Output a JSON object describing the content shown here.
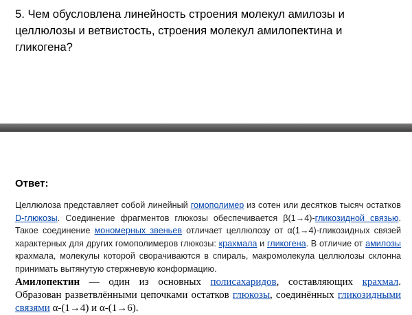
{
  "question": "5. Чем обусловлена линейность строения молекул амилозы и целлюлозы и ветвистость, строения молекул амилопектина и гликогена?",
  "answer_heading": "Ответ:",
  "para1": {
    "t1": "Целлюлоза представляет собой линейный ",
    "l1": "гомополимер",
    "t2": " из сотен или десятков тысяч остатков ",
    "l2": "D-глюкозы",
    "t3": ". Соединение фрагментов глюкозы обеспечивается β(1→4)-",
    "l3": "гликозидной связью",
    "t4": ". Такое соединение ",
    "l4": "мономерных звеньев",
    "t5": " отличает целлюлозу от α(1→4)-гликозидных связей характерных для других гомополимеров глюкозы: ",
    "l5": "крахмала",
    "t6": " и ",
    "l6": "гликогена",
    "t7": ". В отличие от ",
    "l7": "амилозы",
    "t8": " крахмала, молекулы которой сворачиваются в спираль, макромолекула целлюлозы склонна принимать вытянутую стержневую конформацию."
  },
  "para2": {
    "term": "Амилопектин",
    "t1": " — один из основных ",
    "l1": "полисахаридов",
    "t2": ", составляющих ",
    "l2": "крахмал",
    "t3": ". Образован разветвлёнными цепочками остатков ",
    "l3": "глюкозы",
    "t4": ", соединённых ",
    "l4": "гликозидными связями",
    "t5": " α-(1→4) и α-(1→6)."
  },
  "colors": {
    "link": "#0645ad",
    "divider": "#4a4a4a"
  }
}
